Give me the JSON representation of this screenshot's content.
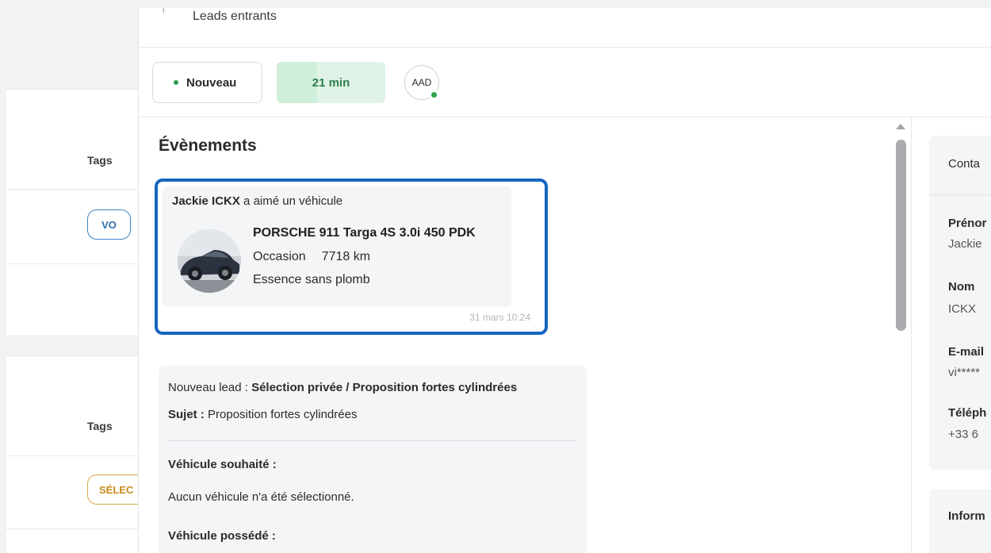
{
  "background_list": {
    "tags_label_1": "Tags",
    "tag_vo": "VO",
    "tags_label_2": "Tags",
    "tag_selection": "SÉLEC"
  },
  "header": {
    "title": "Leads entrants"
  },
  "status_bar": {
    "status_label": "Nouveau",
    "timer": "21 min",
    "assignee_initials": "AAD"
  },
  "events": {
    "title": "Évènements",
    "liked_vehicle": {
      "person": "Jackie ICKX",
      "action": " a aimé un véhicule",
      "car_title": "PORSCHE 911 Targa 4S 3.0i 450 PDK",
      "condition": "Occasion",
      "mileage": "7718 km",
      "fuel": "Essence sans plomb",
      "timestamp": "31 mars 10:24"
    },
    "new_lead": {
      "prefix": "Nouveau lead : ",
      "source": "Sélection privée / Proposition fortes cylindrées",
      "subject_label": "Sujet : ",
      "subject": "Proposition fortes cylindrées",
      "wanted_label": "Véhicule souhaité :",
      "wanted_value": "Aucun véhicule n'a été sélectionné.",
      "owned_label": "Véhicule possédé :"
    }
  },
  "contact": {
    "title": "Conta",
    "first_name_label": "Prénor",
    "first_name": "Jackie",
    "last_name_label": "Nom",
    "last_name": "ICKX",
    "email_label": "E-mail",
    "email": "vi*****",
    "phone_label": "Téléph",
    "phone": "+33 6",
    "info_title": "Inform"
  },
  "colors": {
    "highlight_border": "#1565c0",
    "status_green": "#2d9a4e",
    "timer_bg": "#dff4e7"
  }
}
